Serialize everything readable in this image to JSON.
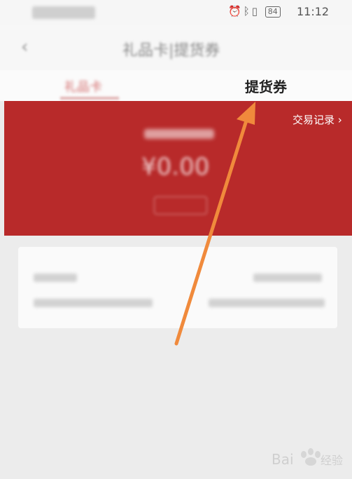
{
  "status_bar": {
    "time": "11:12",
    "battery": "84"
  },
  "header": {
    "title": "礼品卡|提货券"
  },
  "tabs": {
    "left": "礼品卡",
    "right": "提货券"
  },
  "banner": {
    "amount": "¥0.00",
    "trade_records": "交易记录 ›"
  },
  "watermark": {
    "text": "Bai 经验"
  },
  "colors": {
    "banner_red": "#b82a2a",
    "arrow_orange": "#f08a3c",
    "background": "#ececec"
  }
}
